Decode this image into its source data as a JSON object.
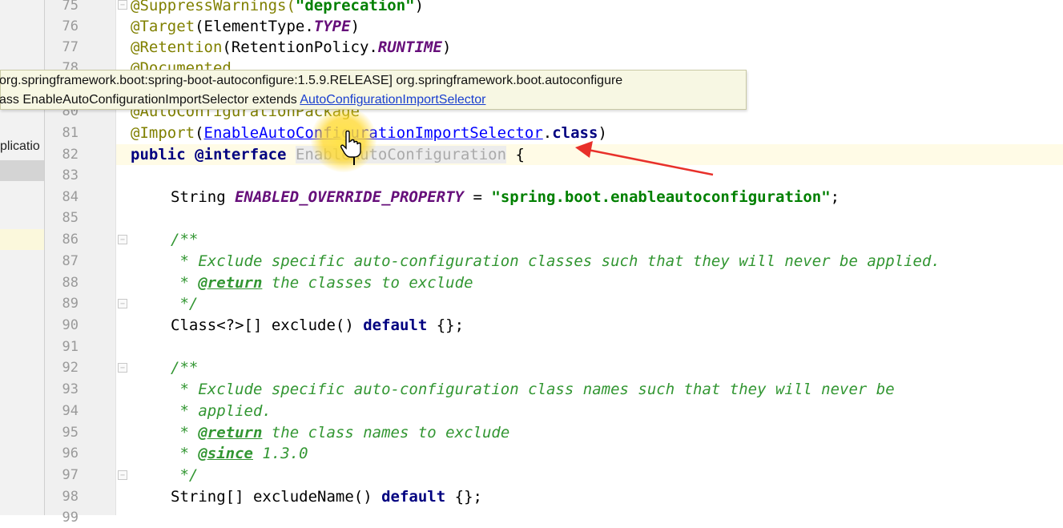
{
  "sidebar": {
    "items": [
      "plicatio"
    ]
  },
  "tooltip": {
    "line1": "org.springframework.boot:spring-boot-autoconfigure:1.5.9.RELEASE] org.springframework.boot.autoconfigure",
    "line2_prefix": "ass EnableAutoConfigurationImportSelector extends ",
    "line2_link": "AutoConfigurationImportSelector"
  },
  "editor": {
    "line_numbers": [
      "75",
      "76",
      "77",
      "78",
      "80",
      "81",
      "82",
      "83",
      "84",
      "85",
      "86",
      "87",
      "88",
      "89",
      "90",
      "91",
      "92",
      "93",
      "94",
      "95",
      "96",
      "97",
      "98",
      "99"
    ],
    "l75": {
      "ann": "@SuppressWarnings(",
      "str": "\"deprecation\"",
      "tail": ")"
    },
    "l76": {
      "ann": "@Target",
      "a": "(ElementType.",
      "const": "TYPE",
      "tail": ")"
    },
    "l77": {
      "ann": "@Retention",
      "a": "(RetentionPolicy.",
      "const": "RUNTIME",
      "tail": ")"
    },
    "l78": {
      "ann": "@Documented"
    },
    "l80": {
      "ann": "@AutoConfigurationPackage"
    },
    "l81": {
      "ann": "@Import",
      "paren": "(",
      "link": "EnableAutoConfigurationImportSelector",
      "dot": ".",
      "kw": "class",
      "tail": ")"
    },
    "l82": {
      "kw1": "public",
      "kw2": "@interface",
      "ident": "EnableAutoConfiguration",
      "tail": "{"
    },
    "l84": {
      "type": "String",
      "const": "ENABLED_OVERRIDE_PROPERTY",
      "eq": " = ",
      "str": "\"spring.boot.enableautoconfiguration\"",
      "tail": ";"
    },
    "l86": "/**",
    "l87": " * Exclude specific auto-configuration classes such that they will never be applied.",
    "l88": {
      "star": " * ",
      "tag": "@return",
      "text": " the classes to exclude"
    },
    "l89": " */",
    "l90": {
      "a": "Class<?>[] exclude() ",
      "kw": "default",
      "tail": " {};"
    },
    "l92": "/**",
    "l93": " * Exclude specific auto-configuration class names such that they will never be",
    "l94": " * applied.",
    "l95": {
      "star": " * ",
      "tag": "@return",
      "text": " the class names to exclude"
    },
    "l96": {
      "star": " * ",
      "tag": "@since",
      "text": " 1.3.0"
    },
    "l97": " */",
    "l98": {
      "a": "String[] excludeName() ",
      "kw": "default",
      "tail": " {};"
    }
  },
  "colors": {
    "annotation": "#808000",
    "keyword": "#000080",
    "string": "#008000",
    "constant": "#660e7a",
    "comment": "#329632",
    "link": "#0000ff",
    "arrow": "#e8302a",
    "highlight": "#ffd834"
  }
}
